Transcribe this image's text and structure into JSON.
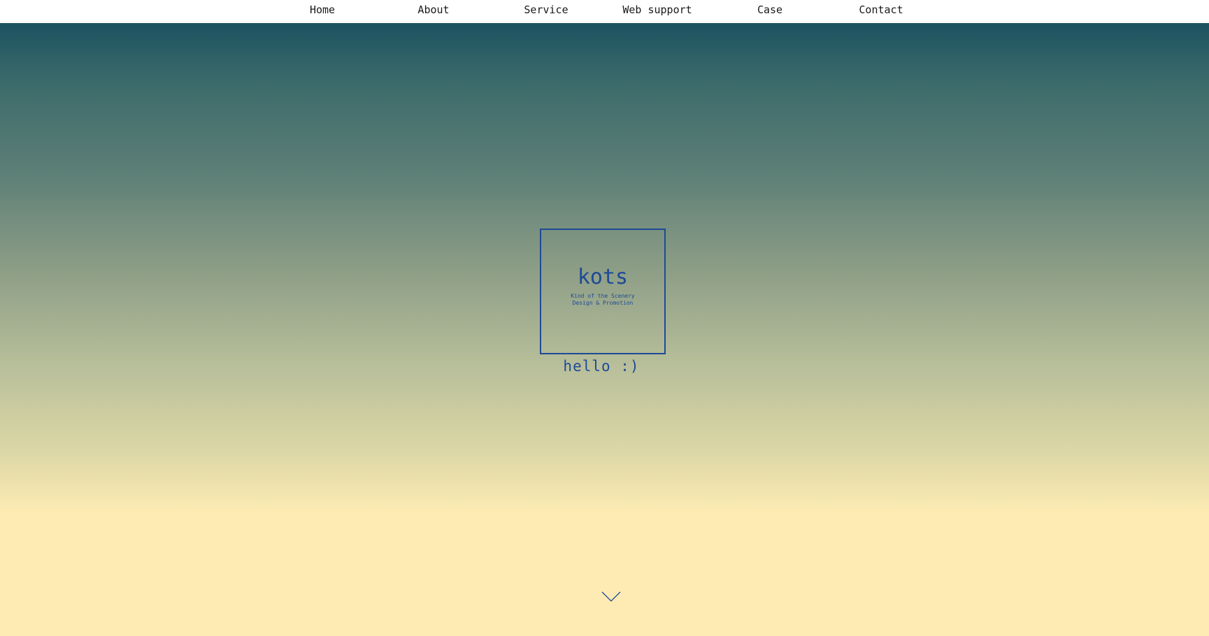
{
  "nav": {
    "items": [
      {
        "label": "Home"
      },
      {
        "label": "About"
      },
      {
        "label": "Service"
      },
      {
        "label": "Web support"
      },
      {
        "label": "Case"
      },
      {
        "label": "Contact"
      }
    ]
  },
  "hero": {
    "logo": {
      "title": "kots",
      "subtitle_line1": "Kind of the Scenery",
      "subtitle_line2": "Design & Promotion"
    },
    "greeting": "hello :)",
    "scroll_icon": "chevron-down-icon"
  },
  "colors": {
    "accent": "#1e4a96",
    "gradient_top": "#1c5361",
    "gradient_bottom": "#feebb3",
    "nav_background": "#ffffff",
    "nav_text": "#1a1a1a"
  }
}
